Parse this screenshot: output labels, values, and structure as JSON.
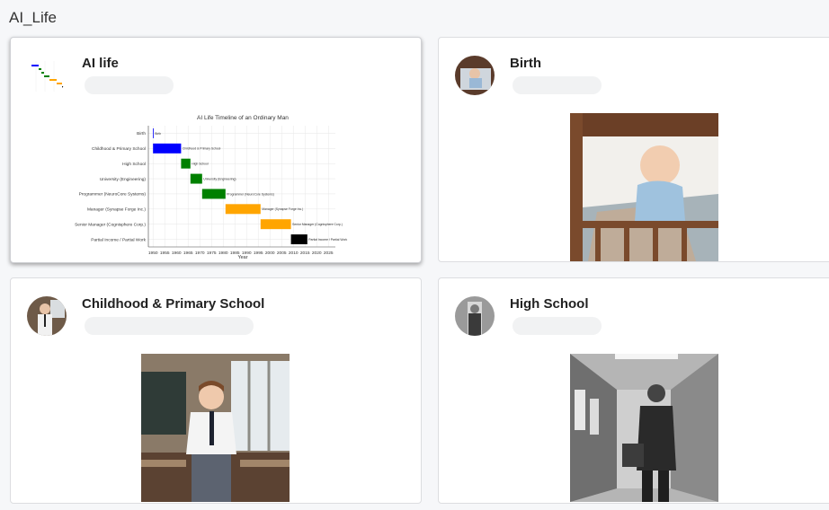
{
  "page": {
    "title": "AI_Life"
  },
  "cards": [
    {
      "title": "AI life",
      "chart_data": {
        "type": "bar",
        "title": "AI Life Timeline of an Ordinary Man",
        "xlabel": "Year",
        "ylabel": "",
        "xlim": [
          1948,
          2028
        ],
        "x_ticks": [
          1950,
          1955,
          1960,
          1965,
          1970,
          1975,
          1980,
          1985,
          1990,
          1995,
          2000,
          2005,
          2010,
          2015,
          2020,
          2025
        ],
        "grid": true,
        "categories": [
          "Birth",
          "Childhood & Primary School",
          "High School",
          "University (Engineering)",
          "Programmer (NeuroCore Systems)",
          "Manager (Synapse Forge Inc.)",
          "Senior Manager (Cognisphere Corp.)",
          "Partial Income / Partial Work"
        ],
        "series": [
          {
            "start": 1950,
            "end": 1950.2,
            "color": "#0000ff",
            "label": "Birth"
          },
          {
            "start": 1950,
            "end": 1962,
            "color": "#0000ff",
            "label": "Childhood & Primary School"
          },
          {
            "start": 1962,
            "end": 1966,
            "color": "#008000",
            "label": "High School"
          },
          {
            "start": 1966,
            "end": 1971,
            "color": "#008000",
            "label": "University (Engineering)"
          },
          {
            "start": 1971,
            "end": 1981,
            "color": "#008000",
            "label": "Programmer (NeuroCore Systems)"
          },
          {
            "start": 1981,
            "end": 1996,
            "color": "#ffa500",
            "label": "Manager (Synapse Forge Inc.)"
          },
          {
            "start": 1996,
            "end": 2009,
            "color": "#ffa500",
            "label": "Senior Manager (Cognisphere Corp.)"
          },
          {
            "start": 2009,
            "end": 2016,
            "color": "#000000",
            "label": "Partial Income / Partial Work"
          }
        ]
      }
    },
    {
      "title": "Birth"
    },
    {
      "title": "Childhood & Primary School"
    },
    {
      "title": "High School"
    }
  ],
  "icons": {
    "avatar_ai_life": "chart-thumbnail-icon",
    "avatar_birth": "baby-photo-icon",
    "avatar_childhood": "schoolboy-photo-icon",
    "avatar_high_school": "teenager-photo-icon"
  }
}
